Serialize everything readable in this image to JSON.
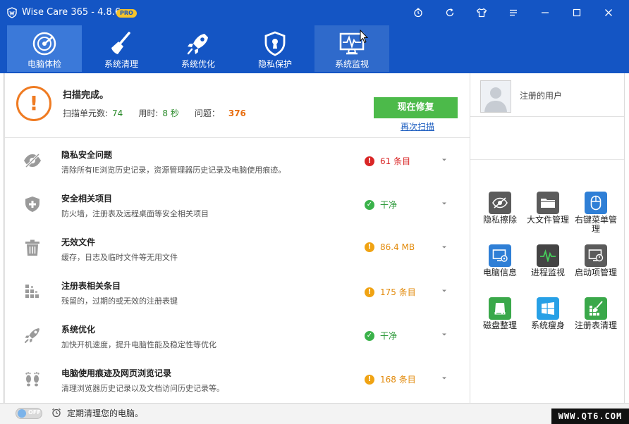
{
  "app": {
    "title": "Wise Care 365 - 4.8.6",
    "badge": "PRO",
    "colors": {
      "titlebar": "#1455c4",
      "active_tab": "#3b79d9",
      "fix_button": "#4cba4a",
      "accent_orange": "#ef7b22"
    }
  },
  "window_controls": [
    {
      "name": "timer-icon"
    },
    {
      "name": "refresh-icon"
    },
    {
      "name": "shirt-skin-icon"
    },
    {
      "name": "menu-icon"
    },
    {
      "name": "minimize-icon"
    },
    {
      "name": "maximize-icon"
    },
    {
      "name": "close-icon"
    }
  ],
  "tabs": [
    {
      "label": "电脑体检",
      "icon": "radar-checkup-icon",
      "active": true
    },
    {
      "label": "系统清理",
      "icon": "broom-icon",
      "active": false
    },
    {
      "label": "系统优化",
      "icon": "rocket-icon",
      "active": false
    },
    {
      "label": "隐私保护",
      "icon": "shield-keyhole-icon",
      "active": false
    },
    {
      "label": "系统监视",
      "icon": "monitor-pulse-icon",
      "active": false
    }
  ],
  "scan": {
    "title": "扫描完成。",
    "units_label": "扫描单元数:",
    "units_value": "74",
    "time_label": "用时:",
    "time_value": "8 秒",
    "issues_label": "问题：",
    "issues_value": "376",
    "fix_button": "现在修复",
    "rescan_link": "再次扫描"
  },
  "issues": [
    {
      "icon": "eye-slash-icon",
      "title": "隐私安全问题",
      "desc": "清除所有IE浏览历史记录，资源管理器历史记录及电脑使用痕迹。",
      "status_type": "error",
      "status": "61 条目"
    },
    {
      "icon": "shield-plus-icon",
      "title": "安全相关项目",
      "desc": "防火墙，注册表及远程桌面等安全相关项目",
      "status_type": "ok",
      "status": "干净"
    },
    {
      "icon": "trash-icon",
      "title": "无效文件",
      "desc": "缓存，日志及临时文件等无用文件",
      "status_type": "warn",
      "status": "86.4 MB"
    },
    {
      "icon": "registry-blocks-icon",
      "title": "注册表相关条目",
      "desc": "残留的，过期的或无效的注册表键",
      "status_type": "warn",
      "status": "175 条目"
    },
    {
      "icon": "rocket-icon",
      "title": "系统优化",
      "desc": "加快开机速度，提升电脑性能及稳定性等优化",
      "status_type": "ok",
      "status": "干净"
    },
    {
      "icon": "footprints-icon",
      "title": "电脑使用痕迹及网页浏览记录",
      "desc": "清理浏览器历史记录以及文档访问历史记录等。",
      "status_type": "warn",
      "status": "168 条目"
    }
  ],
  "user": {
    "name": "注册的用户"
  },
  "tools": [
    {
      "label": "隐私擦除",
      "icon": "privacy-eraser-icon",
      "color": "#5b5b5b"
    },
    {
      "label": "大文件管理",
      "icon": "folder-icon",
      "color": "#5b5b5b"
    },
    {
      "label": "右键菜单管理",
      "icon": "mouse-icon",
      "color": "#2f7fd6"
    },
    {
      "label": "电脑信息",
      "icon": "computer-info-icon",
      "color": "#2f7fd6"
    },
    {
      "label": "进程监视",
      "icon": "process-monitor-icon",
      "color": "#444444"
    },
    {
      "label": "启动项管理",
      "icon": "startup-manager-icon",
      "color": "#5b5b5b"
    },
    {
      "label": "磁盘整理",
      "icon": "disk-defrag-icon",
      "color": "#3aa84a"
    },
    {
      "label": "系统瘦身",
      "icon": "windows-slim-icon",
      "color": "#27a0e6"
    },
    {
      "label": "注册表清理",
      "icon": "registry-cleaner-icon",
      "color": "#3aa84a"
    }
  ],
  "statusbar": {
    "toggle": "OFF",
    "text": "定期清理您的电脑。"
  },
  "watermark": "WWW.QT6.COM"
}
